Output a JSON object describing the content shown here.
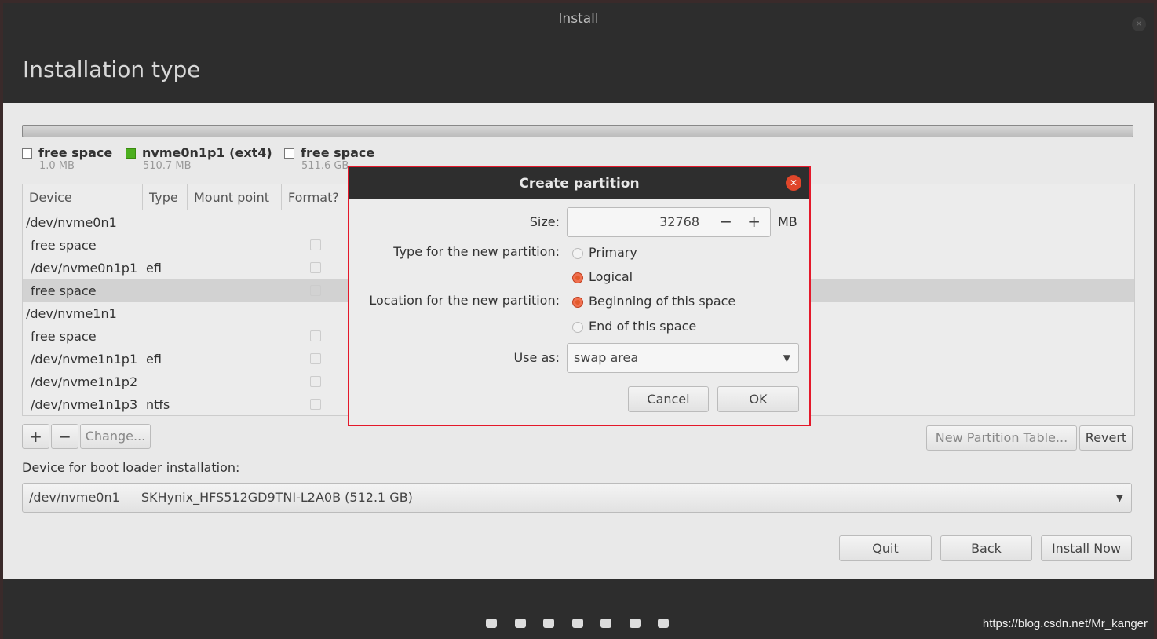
{
  "window": {
    "title": "Install",
    "page_title": "Installation type"
  },
  "legend": [
    {
      "label": "free space",
      "size": "1.0 MB",
      "color": "#ffffff"
    },
    {
      "label": "nvme0n1p1 (ext4)",
      "size": "510.7 MB",
      "color": "#4caf1e"
    },
    {
      "label": "free space",
      "size": "511.6 GB",
      "color": "#ffffff"
    }
  ],
  "table": {
    "headers": [
      "Device",
      "Type",
      "Mount point",
      "Format?"
    ],
    "rows": [
      {
        "device": "/dev/nvme0n1",
        "type": "",
        "indent": false
      },
      {
        "device": "free space",
        "indent": true
      },
      {
        "device": "/dev/nvme0n1p1",
        "type": "efi",
        "indent": true
      },
      {
        "device": "free space",
        "indent": true,
        "selected": true
      },
      {
        "device": "/dev/nvme1n1",
        "indent": false
      },
      {
        "device": "free space",
        "indent": true
      },
      {
        "device": "/dev/nvme1n1p1",
        "type": "efi",
        "indent": true
      },
      {
        "device": "/dev/nvme1n1p2",
        "indent": true
      },
      {
        "device": "/dev/nvme1n1p3",
        "type": "ntfs",
        "indent": true
      }
    ]
  },
  "toolbar": {
    "add": "+",
    "remove": "−",
    "change": "Change...",
    "new_table": "New Partition Table...",
    "revert": "Revert"
  },
  "bootloader": {
    "label": "Device for boot loader installation:",
    "device": "/dev/nvme0n1",
    "model": "SKHynix_HFS512GD9TNI-L2A0B (512.1 GB)"
  },
  "nav": {
    "quit": "Quit",
    "back": "Back",
    "install": "Install Now",
    "steps": 7
  },
  "dialog": {
    "title": "Create partition",
    "size_label": "Size:",
    "size_value": "32768",
    "unit": "MB",
    "minus": "−",
    "plus": "+",
    "type_label": "Type for the new partition:",
    "type_options": [
      "Primary",
      "Logical"
    ],
    "type_selected": "Logical",
    "location_label": "Location for the new partition:",
    "location_options": [
      "Beginning of this space",
      "End of this space"
    ],
    "location_selected": "Beginning of this space",
    "use_as_label": "Use as:",
    "use_as_value": "swap area",
    "cancel": "Cancel",
    "ok": "OK",
    "highlight_color": "#e4182a"
  },
  "watermark": "https://blog.csdn.net/Mr_kanger"
}
